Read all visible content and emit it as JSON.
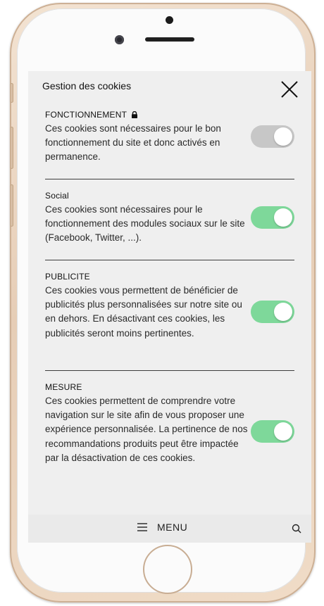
{
  "modal": {
    "title": "Gestion des cookies",
    "close_icon": "close-icon"
  },
  "colors": {
    "toggle_on": "#7ed89a",
    "toggle_off": "#c7c7c7",
    "screen_bg": "#efefef",
    "phone_gold": "#e6cdb6"
  },
  "sections": [
    {
      "title": "FONCTIONNEMENT",
      "icon": "lock-icon",
      "description": "Ces cookies sont nécessaires pour le bon fonctionnement du site et donc activés en permanence.",
      "toggle_on": true,
      "toggle_color": "#c7c7c7"
    },
    {
      "title": "Social",
      "description": "Ces cookies sont nécessaires pour le fonctionnement des modules sociaux sur le site (Facebook, Twitter, ...).",
      "toggle_on": true,
      "toggle_color": "#7ed89a"
    },
    {
      "title": "PUBLICITE",
      "description": "Ces cookies vous permettent de bénéficier de publicités plus personnalisées sur notre site ou en dehors. En désactivant ces cookies, les publicités seront moins pertinentes.",
      "toggle_on": true,
      "toggle_color": "#7ed89a"
    },
    {
      "title": "MESURE",
      "description": "Ces cookies permettent de comprendre votre navigation sur le site afin de vous proposer une expérience personnalisée. La pertinence de nos recommandations produits peut être impactée par la désactivation de ces cookies.",
      "toggle_on": true,
      "toggle_color": "#7ed89a"
    }
  ],
  "bottom_bar": {
    "menu_label": "MENU",
    "menu_icon": "hamburger-icon",
    "search_icon": "search-icon"
  }
}
